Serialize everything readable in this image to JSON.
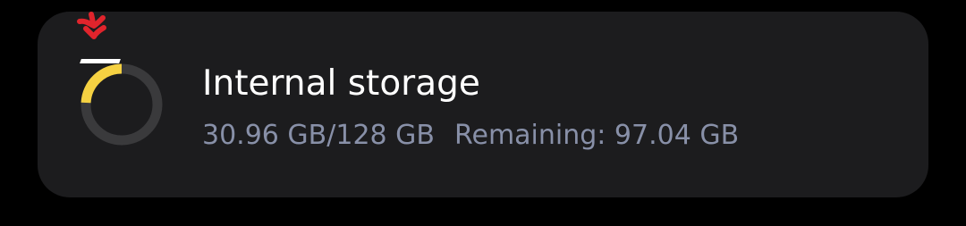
{
  "storage": {
    "title": "Internal storage",
    "used": "30.96 GB/128 GB",
    "remaining": "Remaining: 97.04 GB",
    "used_fraction": 0.2419,
    "ring_track_color": "#3a3a3c",
    "ring_fill_color": "#f5d142",
    "card_color": "#1c1c1e"
  },
  "annotation": {
    "icon": "red-arrow-icon",
    "color": "#e0242c"
  }
}
